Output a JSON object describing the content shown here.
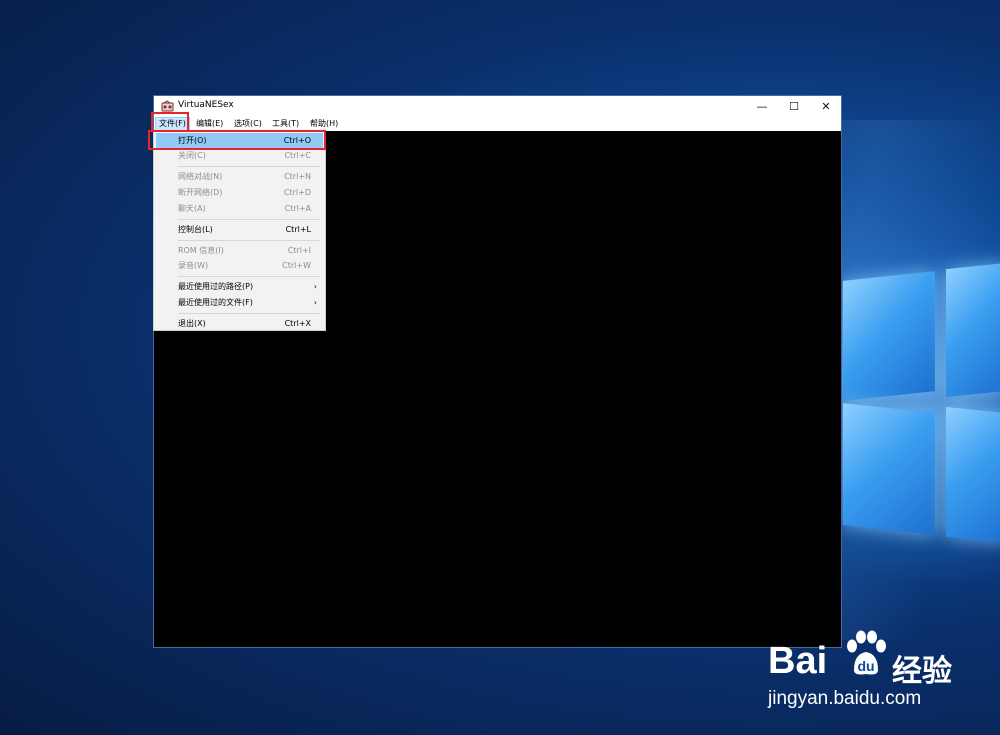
{
  "window": {
    "title": "VirtuaNESex",
    "controls": {
      "minimize": "—",
      "maximize": "☐",
      "close": "✕"
    }
  },
  "menu_bar": {
    "file": "文件(F)",
    "edit": "编辑(E)",
    "options": "选项(C)",
    "tools": "工具(T)",
    "help": "帮助(H)"
  },
  "file_menu": {
    "open": {
      "label": "打开(O)",
      "shortcut": "Ctrl+O"
    },
    "close": {
      "label": "关闭(C)",
      "shortcut": "Ctrl+C"
    },
    "netplay": {
      "label": "网络对战(N)",
      "shortcut": "Ctrl+N"
    },
    "disconnect": {
      "label": "断开网络(D)",
      "shortcut": "Ctrl+D"
    },
    "chat": {
      "label": "聊天(A)",
      "shortcut": "Ctrl+A"
    },
    "console": {
      "label": "控制台(L)",
      "shortcut": "Ctrl+L"
    },
    "rom_info": {
      "label": "ROM 信息(I)",
      "shortcut": "Ctrl+I"
    },
    "record": {
      "label": "录音(W)",
      "shortcut": "Ctrl+W"
    },
    "recent_paths": {
      "label": "最近使用过的路径(P)",
      "arrow": "›"
    },
    "recent_files": {
      "label": "最近使用过的文件(F)",
      "arrow": "›"
    },
    "exit": {
      "label": "退出(X)",
      "shortcut": "Ctrl+X"
    }
  },
  "watermark": {
    "brand": "Bai",
    "brand_suffix": "经验",
    "url": "jingyan.baidu.com"
  },
  "colors": {
    "highlight_box": "#e8262a",
    "selected_item": "#91c9f7",
    "screen": "#000000"
  }
}
